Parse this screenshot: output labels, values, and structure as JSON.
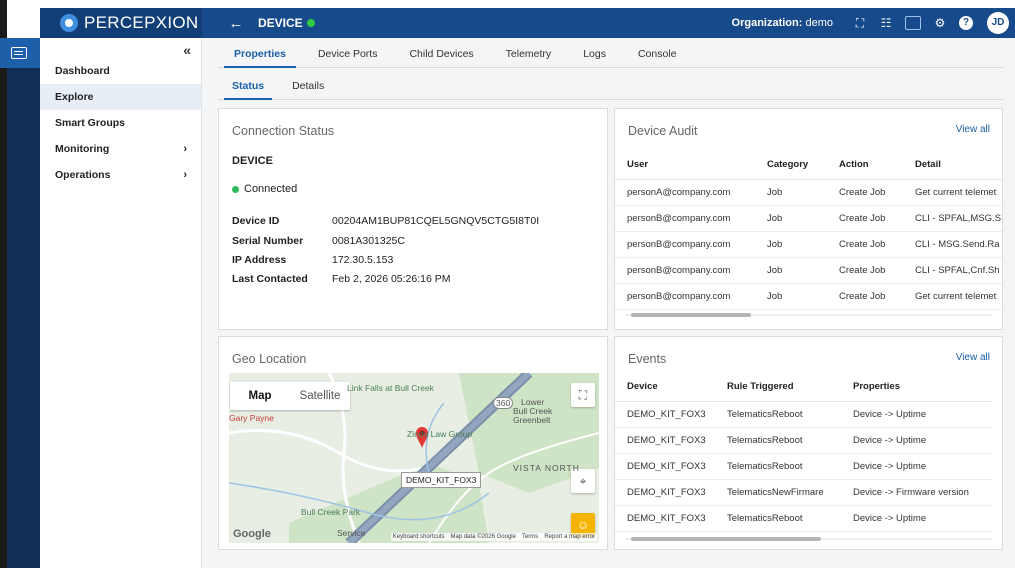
{
  "app": {
    "brand": "PERCEPXION"
  },
  "header": {
    "back_icon": "arrow-left-icon",
    "title": "DEVICE",
    "org_label": "Organization:",
    "org_value": "demo",
    "avatar_initials": "JD"
  },
  "sidebar": {
    "collapse_label": "«",
    "items": [
      {
        "label": "Dashboard"
      },
      {
        "label": "Explore"
      },
      {
        "label": "Smart Groups"
      },
      {
        "label": "Monitoring",
        "chevron": "›"
      },
      {
        "label": "Operations",
        "chevron": "›"
      }
    ]
  },
  "tabs": [
    "Properties",
    "Device Ports",
    "Child Devices",
    "Telemetry",
    "Logs",
    "Console"
  ],
  "subtabs": [
    "Status",
    "Details"
  ],
  "connection": {
    "title": "Connection Status",
    "device": "DEVICE",
    "status": "Connected",
    "fields": [
      {
        "key": "Device ID",
        "value": "00204AM1BUP81CQEL5GNQV5CTG5I8T0I"
      },
      {
        "key": "Serial Number",
        "value": "0081A301325C"
      },
      {
        "key": "IP Address",
        "value": "172.30.5.153"
      },
      {
        "key": "Last Contacted",
        "value": "Feb 2, 2026 05:26:16 PM"
      }
    ]
  },
  "audit": {
    "title": "Device Audit",
    "view_all": "View all",
    "columns": [
      "User",
      "Category",
      "Action",
      "Detail"
    ],
    "rows": [
      [
        "personA@company.com",
        "Job",
        "Create Job",
        "Get current telemet"
      ],
      [
        "personB@company.com",
        "Job",
        "Create Job",
        "CLI - SPFAL,MSG.S"
      ],
      [
        "personB@company.com",
        "Job",
        "Create Job",
        "CLI - MSG.Send.Ra"
      ],
      [
        "personB@company.com",
        "Job",
        "Create Job",
        "CLI - SPFAL,Cnf.Sh"
      ],
      [
        "personB@company.com",
        "Job",
        "Create Job",
        "Get current telemet"
      ]
    ]
  },
  "geo": {
    "title": "Geo Location",
    "map_tab": "Map",
    "satellite_tab": "Satellite",
    "pin_label": "DEMO_KIT_FOX3",
    "places": {
      "link_falls": "Link Falls at Bull Creek",
      "lower_bull": "Lower",
      "lower_bull2": "Bull Creek",
      "lower_bull3": "Greenbelt",
      "gary": "Gary Payne",
      "zinda": "Zinda Law Group",
      "vista": "VISTA NORTH",
      "bull_park": "Bull Creek Park",
      "service": "Service",
      "hwy": "360"
    },
    "google": "Google",
    "attribution": [
      "Keyboard shortcuts",
      "Map data ©2026 Google",
      "Terms",
      "Report a map error"
    ]
  },
  "events": {
    "title": "Events",
    "view_all": "View all",
    "columns": [
      "Device",
      "Rule Triggered",
      "Properties"
    ],
    "rows": [
      [
        "DEMO_KIT_FOX3",
        "TelematicsReboot",
        "Device -> Uptime"
      ],
      [
        "DEMO_KIT_FOX3",
        "TelematicsReboot",
        "Device -> Uptime"
      ],
      [
        "DEMO_KIT_FOX3",
        "TelematicsReboot",
        "Device -> Uptime"
      ],
      [
        "DEMO_KIT_FOX3",
        "TelematicsNewFirmare",
        "Device -> Firmware version"
      ],
      [
        "DEMO_KIT_FOX3",
        "TelematicsReboot",
        "Device -> Uptime"
      ]
    ]
  },
  "colors": {
    "topbar": "#174a8b",
    "accent": "#1a5fa8",
    "connected": "#2eb85c"
  }
}
